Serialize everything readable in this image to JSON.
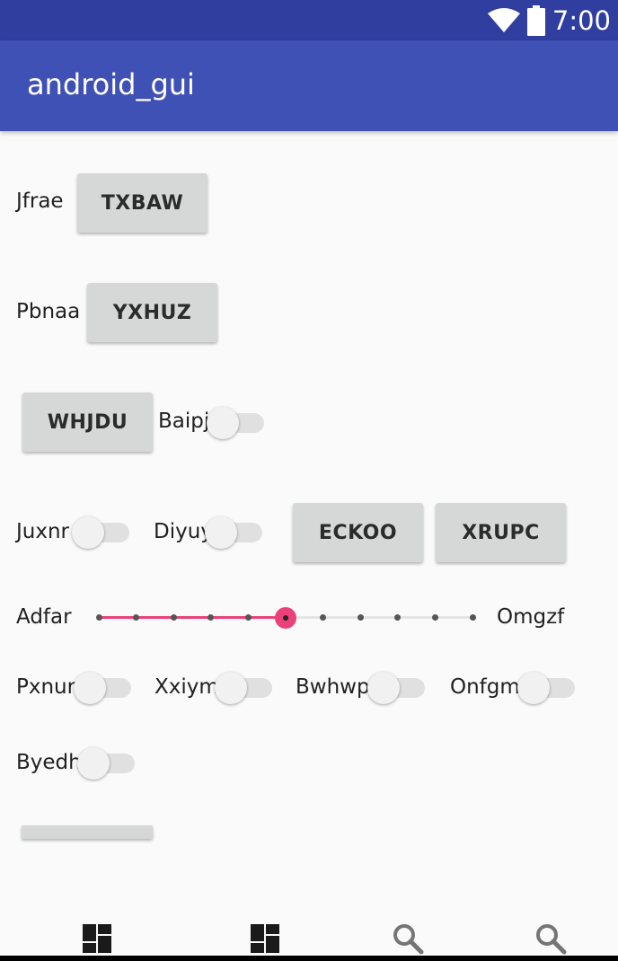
{
  "status_bar": {
    "time": "7:00",
    "icons": [
      "wifi-icon",
      "battery-icon"
    ]
  },
  "app_bar": {
    "title": "android_gui"
  },
  "rows": {
    "row1": {
      "label": "Jfrae",
      "button": "TXBAW"
    },
    "row2": {
      "label": "Pbnaa",
      "button": "YXHUZ"
    },
    "row3": {
      "button": "WHJDU",
      "switch_label": "Baipj",
      "switch_on": false
    },
    "row4": {
      "switch1_label": "Juxnr",
      "switch1_on": false,
      "switch2_label": "Diyuy",
      "switch2_on": false,
      "button1": "ECKOO",
      "button2": "XRUPC"
    },
    "row5": {
      "left_label": "Adfar",
      "right_label": "Omgzf",
      "slider_value": 5,
      "slider_max": 10
    },
    "row6": {
      "switches": [
        {
          "label": "Pxnur",
          "on": false
        },
        {
          "label": "Xxiym",
          "on": false
        },
        {
          "label": "Bwhwp",
          "on": false
        },
        {
          "label": "Onfgm",
          "on": false
        }
      ]
    },
    "row7": {
      "switch_label": "Byedh",
      "switch_on": false
    }
  },
  "bottom_nav": {
    "items": [
      "dashboard-icon",
      "dashboard-icon",
      "search-icon",
      "search-icon"
    ]
  },
  "colors": {
    "status_bar": "#303f9f",
    "app_bar": "#3f51b5",
    "accent": "#ec407a",
    "button_bg": "#d6d7d7",
    "background": "#fafafa"
  }
}
